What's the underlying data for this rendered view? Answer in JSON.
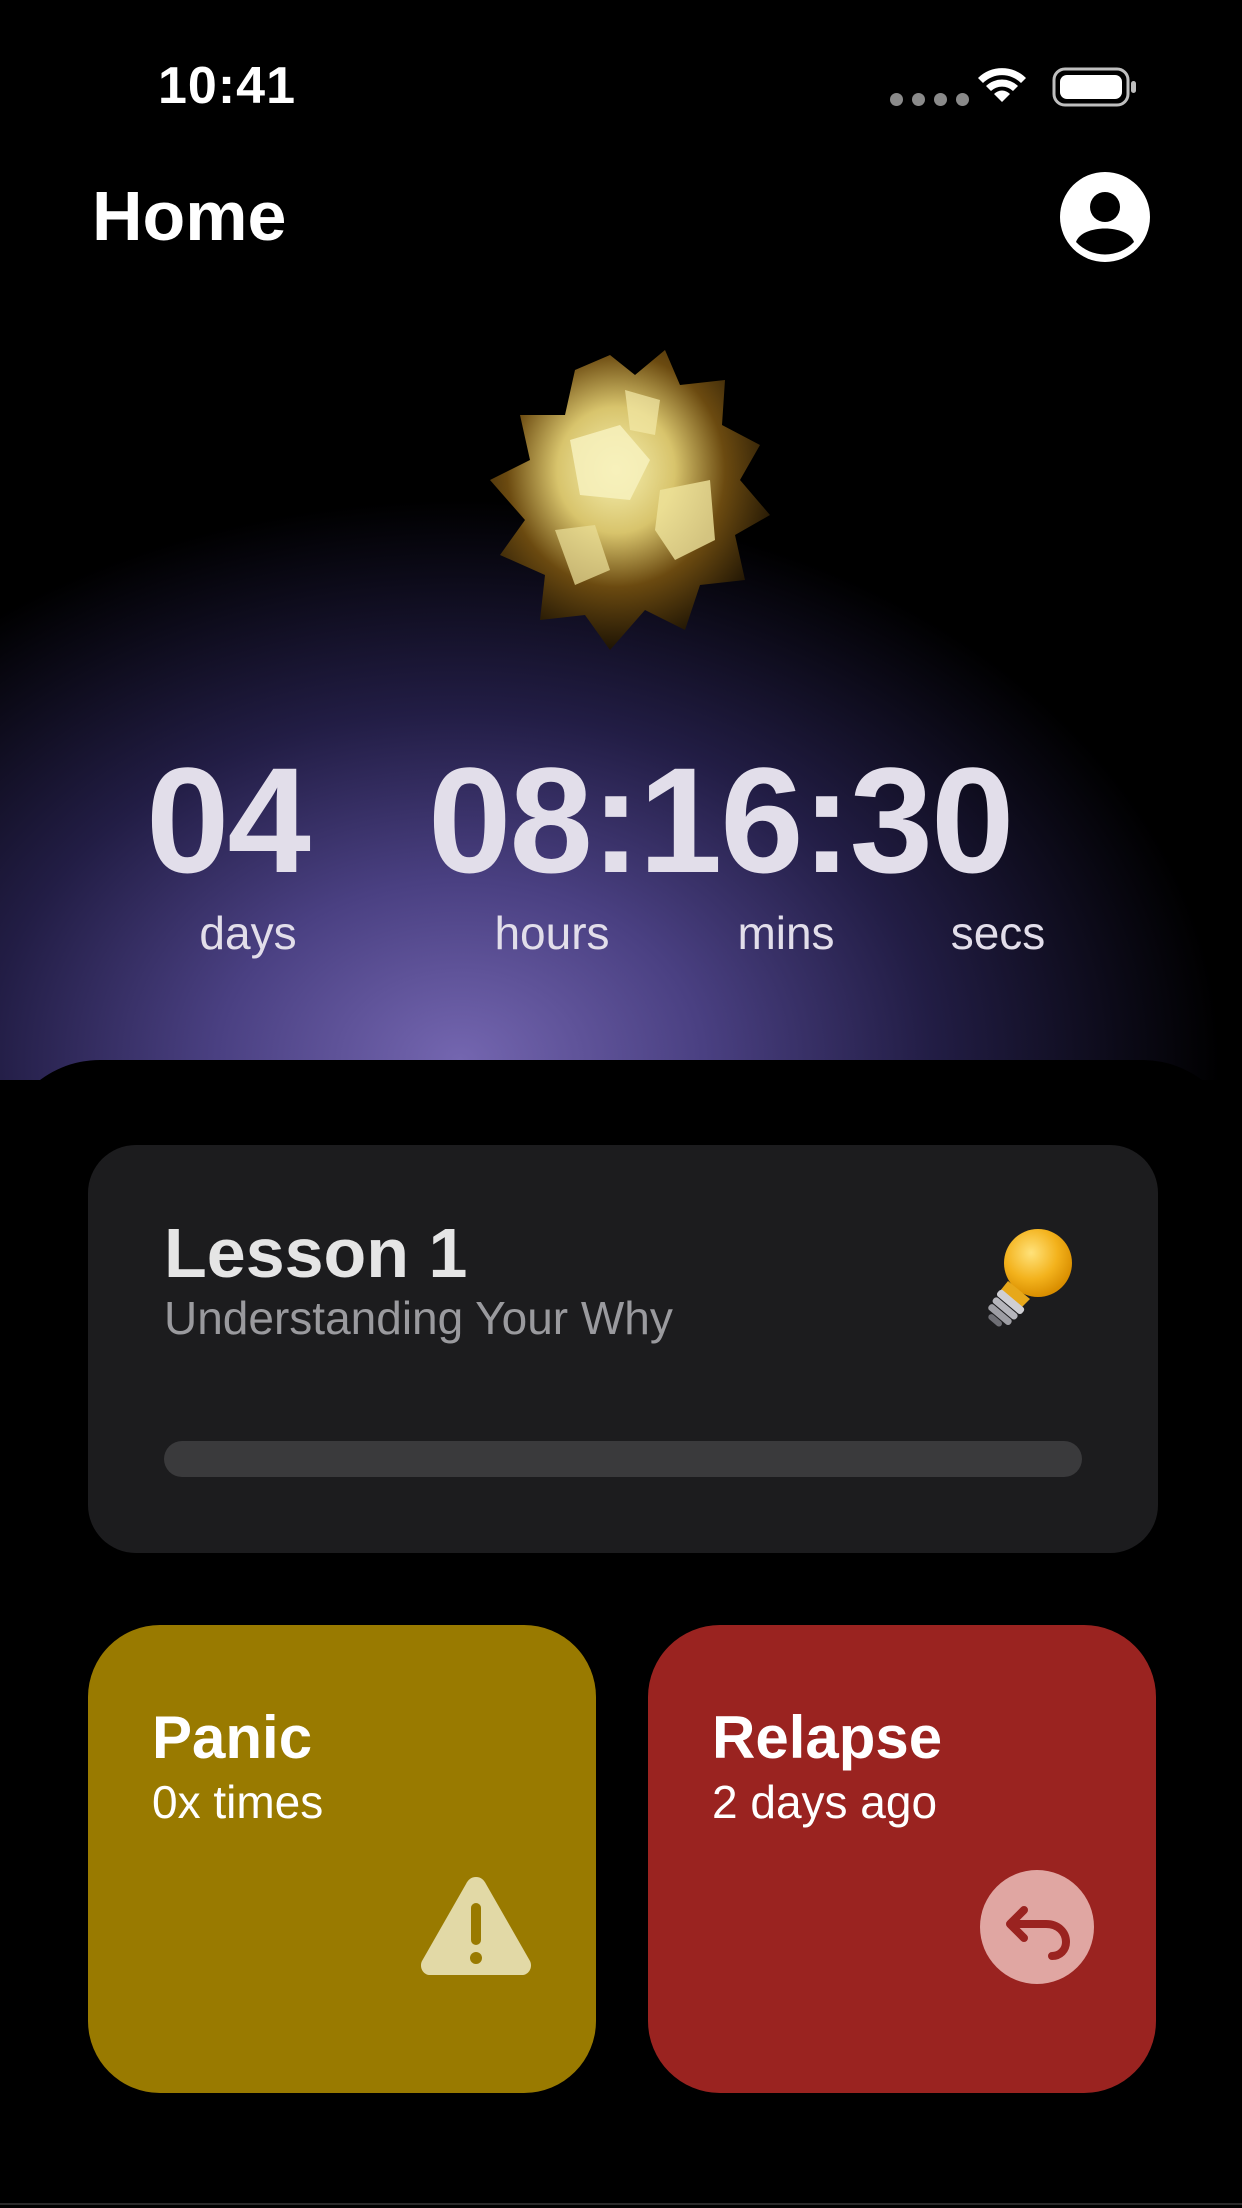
{
  "status_bar": {
    "time": "10:41"
  },
  "header": {
    "title": "Home"
  },
  "timer": {
    "days": "04",
    "clock": "08:16:30",
    "days_label": "days",
    "hours_label": "hours",
    "mins_label": "mins",
    "secs_label": "secs"
  },
  "lesson": {
    "title": "Lesson 1",
    "subtitle": "Understanding Your Why",
    "progress": 0
  },
  "panic": {
    "title": "Panic",
    "subtitle": "0x times"
  },
  "relapse": {
    "title": "Relapse",
    "subtitle": "2 days ago"
  },
  "colors": {
    "panic_tile": "#997a00",
    "relapse_tile": "#9a2320",
    "card_bg": "#1c1c1e",
    "hero_glow": "#7466b0"
  },
  "icons": [
    "wifi-icon",
    "battery-icon",
    "profile-icon",
    "lightbulb-icon",
    "warning-icon",
    "undo-icon"
  ]
}
